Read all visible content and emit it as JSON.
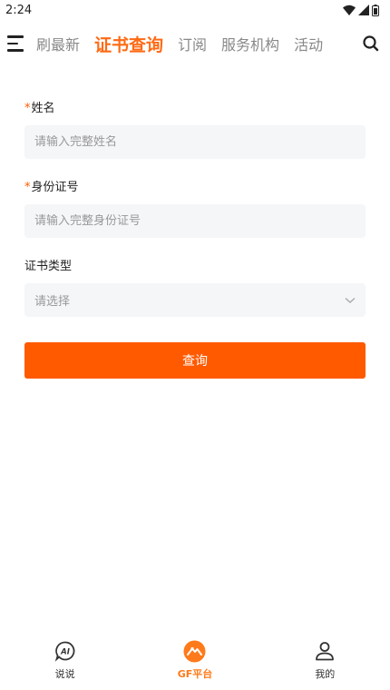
{
  "status_bar": {
    "time": "2:24"
  },
  "top_nav": {
    "tabs": [
      {
        "label": "刷最新"
      },
      {
        "label": "证书查询"
      },
      {
        "label": "订阅"
      },
      {
        "label": "服务机构"
      },
      {
        "label": "活动"
      }
    ],
    "active_tab": "证书查询"
  },
  "form": {
    "required_mark": "*",
    "name": {
      "label": "姓名",
      "placeholder": "请输入完整姓名"
    },
    "id_number": {
      "label": "身份证号",
      "placeholder": "请输入完整身份证号"
    },
    "cert_type": {
      "label": "证书类型",
      "selected": "请选择"
    },
    "submit_label": "查询"
  },
  "bottom_nav": {
    "items": [
      {
        "label": "说说",
        "icon": "ai-chat-icon"
      },
      {
        "label": "GF平台",
        "icon": "gf-platform-icon"
      },
      {
        "label": "我的",
        "icon": "user-icon"
      }
    ],
    "active_item": "GF平台"
  },
  "colors": {
    "accent": "#ff6a13",
    "button": "#ff5a00",
    "input_bg": "#f5f6f8"
  }
}
